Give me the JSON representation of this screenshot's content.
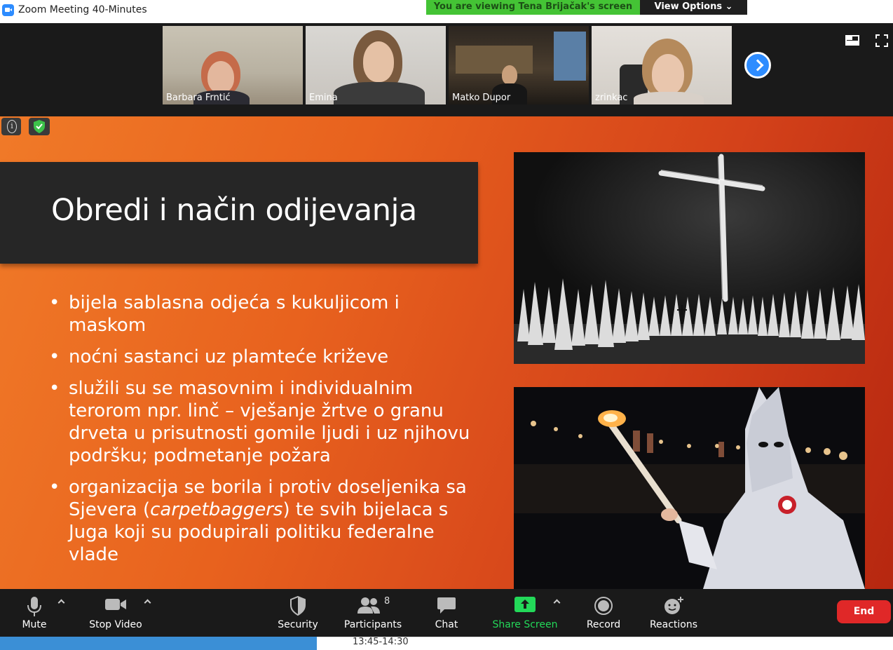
{
  "window": {
    "title": "Zoom Meeting 40-Minutes",
    "viewing_banner": "You are viewing Tena Brijačak's screen",
    "view_options": "View Options ⌄"
  },
  "participants": [
    {
      "name": "Barbara Frntić"
    },
    {
      "name": "Emina"
    },
    {
      "name": "Matko Dupor"
    },
    {
      "name": "zrinkac"
    }
  ],
  "slide": {
    "title": "Obredi i način odijevanja",
    "bullets": [
      {
        "text": "bijela sablasna odjeća s kukuljicom i maskom"
      },
      {
        "text": "noćni sastanci uz plamteće križeve"
      },
      {
        "text": "služili su se masovnim i individualnim terorom npr. linč – vješanje žrtve o granu drveta u prisutnosti gomile ljudi i uz njihovu podršku; podmetanje požara"
      },
      {
        "before": "organizacija se borila i protiv doseljenika sa Sjevera (",
        "italic": "carpetbaggers",
        "after": ") te svih bijelaca s Juga koji su podupirali politiku federalne vlade"
      }
    ]
  },
  "toolbar": {
    "mute": "Mute",
    "stop_video": "Stop Video",
    "security": "Security",
    "participants": "Participants",
    "participants_count": "8",
    "chat": "Chat",
    "share_screen": "Share Screen",
    "record": "Record",
    "reactions": "Reactions",
    "end": "End"
  },
  "taskbar": {
    "time_range": "13:45-14:30"
  },
  "colors": {
    "zoom_blue": "#2d8cff",
    "share_green": "#23d959",
    "end_red": "#e02828",
    "banner_green": "#44c335"
  }
}
